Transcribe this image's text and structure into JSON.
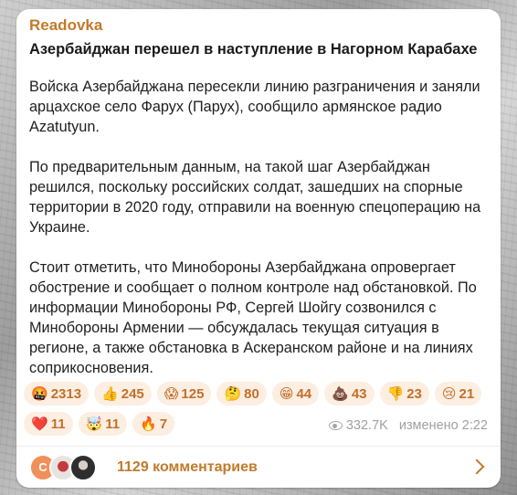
{
  "post": {
    "channel": "Readovka",
    "headline": "Азербайджан перешел в наступление в Нагорном Карабахе",
    "paragraphs": [
      "Войска Азербайджана пересекли линию разграничения и заняли арцахское село Фарух (Парух), сообщило армянское радио Azatutyun.",
      "По предварительным данным, на такой шаг Азербайджан решился, поскольку российских солдат, зашедших на спорные территории в 2020 году, отправили на военную спецоперацию на Украине.",
      "Стоит отметить, что Минобороны Азербайджана опровергает обострение и сообщает о полном контроле над обстановкой. По информации Минобороны РФ, Сергей Шойгу созвонился с Минобороны Армении — обсуждалась текущая ситуация в регионе, а также обстановка в Аскеранском районе и на линиях соприкосновения."
    ]
  },
  "reactions": [
    {
      "icon": "cursing-face-icon",
      "emoji": "🤬",
      "count": "2313"
    },
    {
      "icon": "thumbs-up-icon",
      "emoji": "👍",
      "count": "245"
    },
    {
      "icon": "screaming-face-icon",
      "emoji": "😱",
      "count": "125"
    },
    {
      "icon": "thinking-face-icon",
      "emoji": "🤔",
      "count": "80"
    },
    {
      "icon": "grinning-face-icon",
      "emoji": "😁",
      "count": "44"
    },
    {
      "icon": "poop-icon",
      "emoji": "💩",
      "count": "43"
    },
    {
      "icon": "thumbs-down-icon",
      "emoji": "👎",
      "count": "23"
    },
    {
      "icon": "crying-face-icon",
      "emoji": "😢",
      "count": "21"
    },
    {
      "icon": "heart-icon",
      "emoji": "❤️",
      "count": "11"
    },
    {
      "icon": "exploding-head-icon",
      "emoji": "🤯",
      "count": "11"
    },
    {
      "icon": "fire-icon",
      "emoji": "🔥",
      "count": "7"
    }
  ],
  "meta": {
    "views": "332.7K",
    "edited": "изменено 2:22"
  },
  "comments": {
    "avatar_letter": "C",
    "label": "1129 комментариев"
  },
  "colors": {
    "accent": "#c27a2b",
    "reaction_bg": "#fdeee2"
  }
}
